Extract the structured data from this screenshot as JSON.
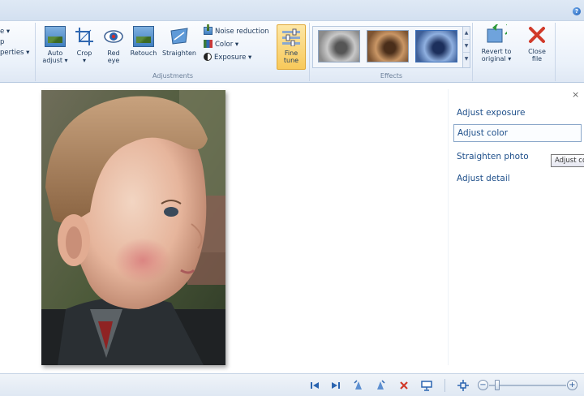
{
  "ribbon": {
    "left_partial": [
      "e ▾",
      "p",
      "perties ▾"
    ],
    "adjustments": {
      "group_label": "Adjustments",
      "auto_adjust": [
        "Auto",
        "adjust ▾"
      ],
      "crop": [
        "Crop",
        "▾"
      ],
      "red_eye": [
        "Red",
        "eye"
      ],
      "retouch": "Retouch",
      "straighten": "Straighten",
      "noise_reduction": "Noise reduction",
      "color": "Color ▾",
      "exposure": "Exposure ▾",
      "fine_tune": [
        "Fine",
        "tune"
      ]
    },
    "effects": {
      "group_label": "Effects"
    },
    "revert": [
      "Revert to",
      "original ▾"
    ],
    "close_file": [
      "Close",
      "file"
    ]
  },
  "fine_tune_pane": {
    "close": "×",
    "items": [
      "Adjust exposure",
      "Adjust color",
      "Straighten photo",
      "Adjust detail"
    ],
    "selected_index": 1,
    "tooltip": "Adjust color"
  },
  "statusbar": {
    "icons": [
      "first-icon",
      "next-icon",
      "rotate-left-icon",
      "rotate-right-icon",
      "delete-icon",
      "slideshow-icon",
      "actual-size-icon"
    ],
    "zoom_level": 0.1
  },
  "colors": {
    "accent": "#2a64b0",
    "ribbon_bg": "#eaf1fa",
    "selected_btn": "#f8c95a"
  }
}
